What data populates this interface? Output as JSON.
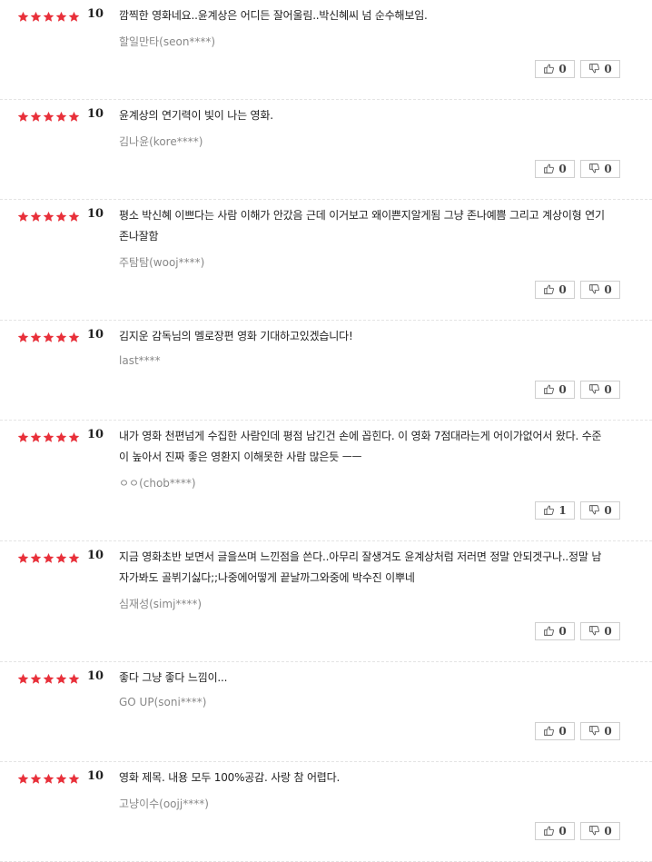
{
  "reviews": [
    {
      "score": "10",
      "text": "깜찍한 영화네요..윤계상은 어디든 잘어울림..박신혜씨 넘 순수해보임.",
      "user": "할일만타(seon****)",
      "likes": "0",
      "dislikes": "0",
      "lines": 1
    },
    {
      "score": "10",
      "text": "윤계상의 연기력이 빛이 나는 영화.",
      "user": "김나윤(kore****)",
      "likes": "0",
      "dislikes": "0",
      "lines": 1
    },
    {
      "score": "10",
      "text": "평소 박신혜 이쁘다는 사람 이해가 안갔음 근데 이거보고 왜이쁜지알게됨 그냥 존나예쁨 그리고 계상이형 연기 존나잘함",
      "user": "주탐탐(wooj****)",
      "likes": "0",
      "dislikes": "0",
      "lines": 2
    },
    {
      "score": "10",
      "text": "김지운 감독님의 멜로장편 영화 기대하고있겠습니다!",
      "user": "last****",
      "likes": "0",
      "dislikes": "0",
      "lines": 1
    },
    {
      "score": "10",
      "text": "내가 영화 천편넘게 수집한 사람인데 평점 남긴건 손에 꼽힌다. 이 영화 7점대라는게 어이가없어서 왔다. 수준이 높아서 진짜 좋은 영환지 이해못한 사람 많은듯 ㅡㅡ",
      "user": "ㅇㅇ(chob****)",
      "likes": "1",
      "dislikes": "0",
      "lines": 2
    },
    {
      "score": "10",
      "text": "지금 영화초반 보면서 글을쓰며 느낀점을 쓴다..아무리 잘생겨도 윤계상처럼 저러면 정말 안되겟구나..정말 남자가봐도 골뷔기싫다;;나중에어떻게 끝날까그와중에 박수진 이뿌네",
      "user": "심재성(simj****)",
      "likes": "0",
      "dislikes": "0",
      "lines": 2
    },
    {
      "score": "10",
      "text": "좋다 그냥 좋다 느낌이...",
      "user": "GO UP(soni****)",
      "likes": "0",
      "dislikes": "0",
      "lines": 1
    },
    {
      "score": "10",
      "text": "영화 제목. 내용 모두 100%공감. 사랑 참 어렵다.",
      "user": "고냥이수(oojj****)",
      "likes": "0",
      "dislikes": "0",
      "lines": 1
    }
  ],
  "colors": {
    "star": "#e8303a",
    "divider": "#e4e4e4",
    "userText": "#888888"
  },
  "icons": {
    "star": "star-icon",
    "like": "thumbs-up-icon",
    "dislike": "thumbs-down-icon"
  }
}
